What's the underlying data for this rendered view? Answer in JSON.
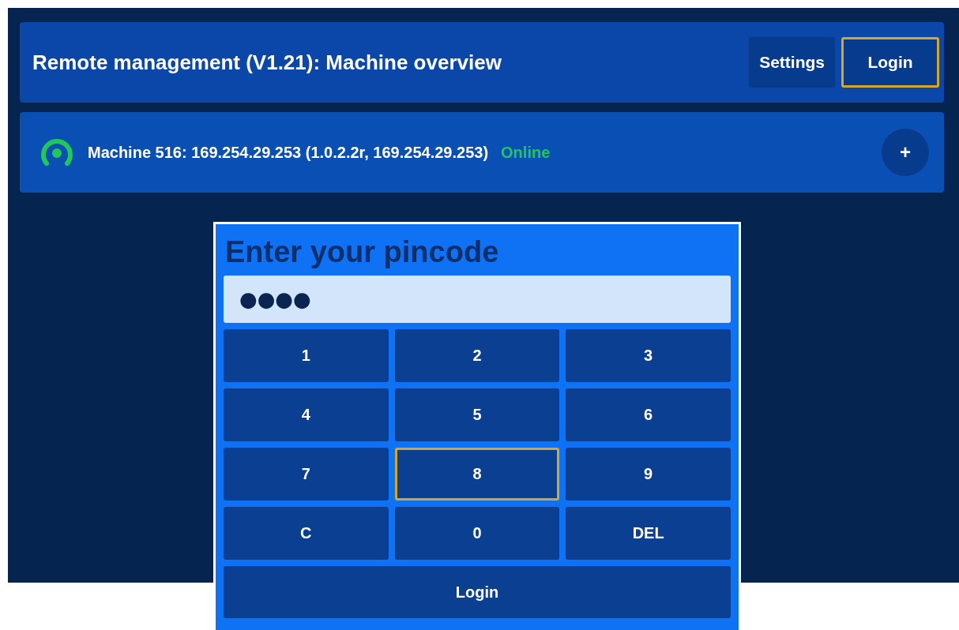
{
  "header": {
    "title": "Remote management (V1.21): Machine overview",
    "buttons": [
      {
        "label": "Settings",
        "selected": false
      },
      {
        "label": "Login",
        "selected": true
      }
    ]
  },
  "machines": [
    {
      "label": "Machine 516: 169.254.29.253 (1.0.2.2r, 169.254.29.253)",
      "status": "Online",
      "online": true,
      "action": "+"
    }
  ],
  "pin_dialog": {
    "title": "Enter your pincode",
    "value": "●●●●",
    "keys": [
      {
        "label": "1",
        "selected": false
      },
      {
        "label": "2",
        "selected": false
      },
      {
        "label": "3",
        "selected": false
      },
      {
        "label": "4",
        "selected": false
      },
      {
        "label": "5",
        "selected": false
      },
      {
        "label": "6",
        "selected": false
      },
      {
        "label": "7",
        "selected": false
      },
      {
        "label": "8",
        "selected": true
      },
      {
        "label": "9",
        "selected": false
      },
      {
        "label": "C",
        "selected": false
      },
      {
        "label": "0",
        "selected": false
      },
      {
        "label": "DEL",
        "selected": false
      }
    ],
    "submit": {
      "label": "Login",
      "selected": false
    }
  }
}
